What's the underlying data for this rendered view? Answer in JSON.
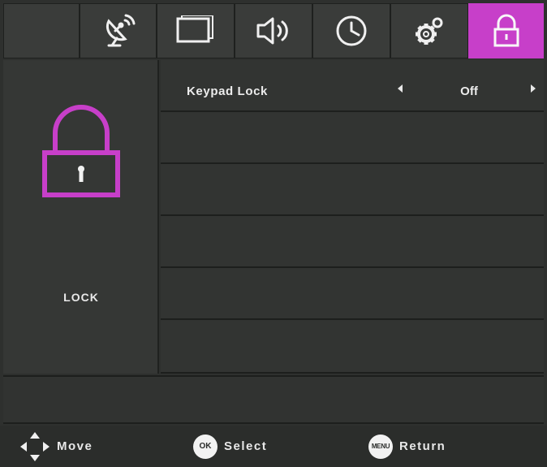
{
  "tabs": [
    {
      "icon": "blank"
    },
    {
      "icon": "satellite-dish-icon"
    },
    {
      "icon": "screen-icon"
    },
    {
      "icon": "speaker-icon"
    },
    {
      "icon": "clock-icon"
    },
    {
      "icon": "gear-icon"
    },
    {
      "icon": "lock-icon",
      "active": true
    }
  ],
  "accent_color": "#c73fc9",
  "left_panel": {
    "title": "LOCK",
    "icon": "padlock-icon"
  },
  "settings": [
    {
      "label": "Keypad Lock",
      "value": "Off"
    },
    {
      "label": "",
      "value": ""
    },
    {
      "label": "",
      "value": ""
    },
    {
      "label": "",
      "value": ""
    },
    {
      "label": "",
      "value": ""
    },
    {
      "label": "",
      "value": ""
    }
  ],
  "footer": {
    "move": "Move",
    "ok_button": "OK",
    "select": "Select",
    "menu_button": "MENU",
    "return": "Return"
  }
}
